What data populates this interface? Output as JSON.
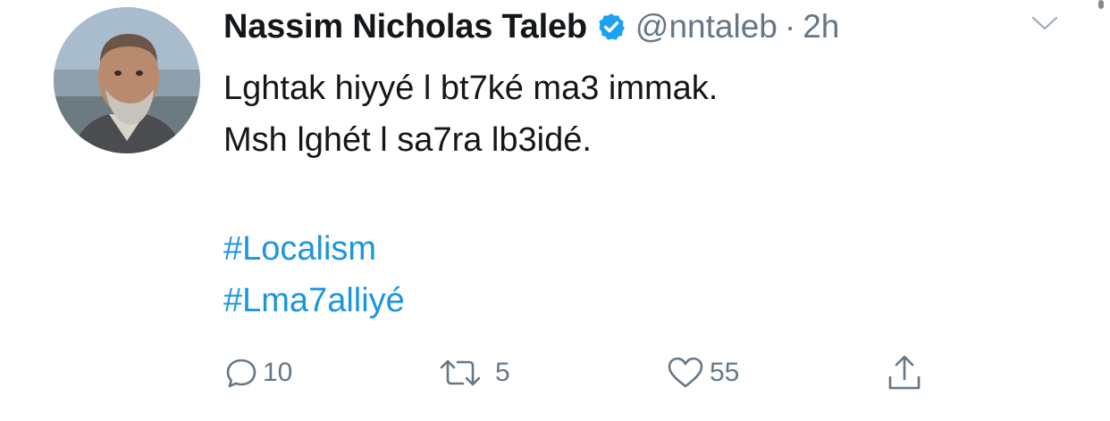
{
  "tweet": {
    "author": {
      "name": "Nassim Nicholas Taleb",
      "handle": "@nntaleb",
      "separator": "·",
      "time": "2h",
      "verified": true,
      "avatar_icon": "profile-photo"
    },
    "text_lines": [
      "Lghtak hiyyé l bt7ké ma3 immak.",
      "Msh lghét l sa7ra lb3idé."
    ],
    "hashtags": [
      "#Localism",
      "#Lma7alliyé"
    ],
    "actions": {
      "reply_count": "10",
      "retweet_count": "5",
      "like_count": "55"
    },
    "icons": {
      "verified": "verified-badge-icon",
      "caret": "chevron-down-icon",
      "reply": "speech-bubble-icon",
      "retweet": "retweet-arrows-icon",
      "like": "heart-icon",
      "share": "share-upload-icon"
    },
    "colors": {
      "text": "#14171a",
      "secondary": "#657786",
      "link": "#1b95e0",
      "verified": "#1da1f2"
    }
  }
}
